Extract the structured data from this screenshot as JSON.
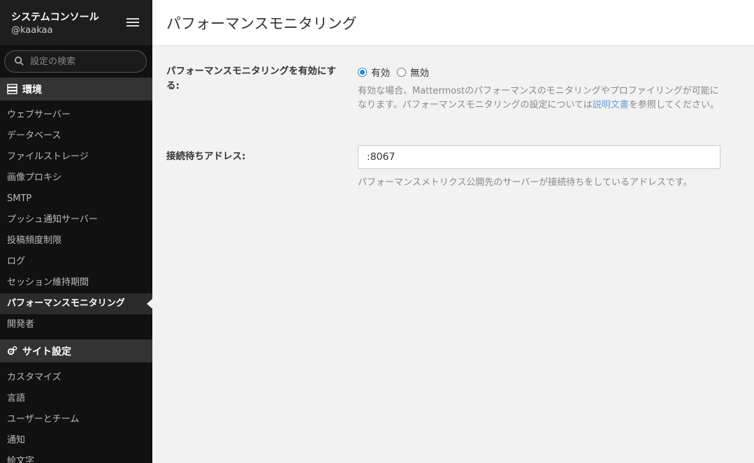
{
  "sidebar": {
    "title": "システムコンソール",
    "username": "@kaakaa",
    "search_placeholder": "設定の検索",
    "sections": [
      {
        "label": "環境",
        "items": [
          {
            "label": "ウェブサーバー"
          },
          {
            "label": "データベース"
          },
          {
            "label": "ファイルストレージ"
          },
          {
            "label": "画像プロキシ"
          },
          {
            "label": "SMTP"
          },
          {
            "label": "プッシュ通知サーバー"
          },
          {
            "label": "投稿頻度制限"
          },
          {
            "label": "ログ"
          },
          {
            "label": "セッション維持期間"
          },
          {
            "label": "パフォーマンスモニタリング",
            "active": true
          },
          {
            "label": "開発者"
          }
        ]
      },
      {
        "label": "サイト設定",
        "items": [
          {
            "label": "カスタマイズ"
          },
          {
            "label": "言語"
          },
          {
            "label": "ユーザーとチーム"
          },
          {
            "label": "通知"
          },
          {
            "label": "絵文字"
          }
        ]
      }
    ]
  },
  "main": {
    "title": "パフォーマンスモニタリング",
    "enable_setting": {
      "label": "パフォーマンスモニタリングを有効にする:",
      "options": [
        "有効",
        "無効"
      ],
      "selected": "有効",
      "help_prefix": "有効な場合、Mattermostのパフォーマンスのモニタリングやプロファイリングが可能になります。パフォーマンスモニタリングの設定については",
      "help_link": "説明文書",
      "help_suffix": "を参照してください。"
    },
    "listen_address": {
      "label": "接続待ちアドレス:",
      "value": ":8067",
      "help": "パフォーマンスメトリクス公開先のサーバーが接続待ちをしているアドレスです。"
    }
  },
  "colors": {
    "sidebar_bg": "#111111",
    "accent": "#2389d7",
    "link": "#6a9fd6"
  }
}
